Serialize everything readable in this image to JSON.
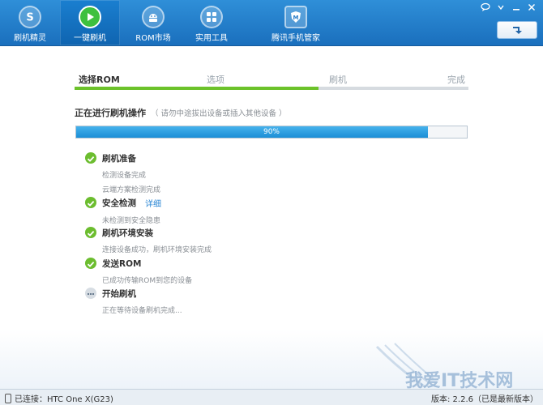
{
  "toolbar": {
    "tabs": [
      {
        "label": "刷机精灵",
        "icon": "shuaji-logo-icon"
      },
      {
        "label": "一键刷机",
        "icon": "play-icon",
        "active": true
      },
      {
        "label": "ROM市场",
        "icon": "android-icon"
      },
      {
        "label": "实用工具",
        "icon": "grid-icon"
      },
      {
        "label": "腾讯手机管家",
        "icon": "shield-m-icon"
      }
    ],
    "window_buttons": [
      "feedback-icon",
      "menu-icon",
      "minimize-icon",
      "close-icon"
    ],
    "update_icon": "arrow-update-icon"
  },
  "steps": {
    "items": [
      "选择ROM",
      "选项",
      "刷机",
      "完成"
    ],
    "current": "选择ROM",
    "progress_fraction": 0.62
  },
  "operation": {
    "title": "正在进行刷机操作",
    "hint": "（ 请勿中途拔出设备或插入其他设备 ）"
  },
  "progress": {
    "percent": 90,
    "text": "90%"
  },
  "tasks": [
    {
      "title": "刷机准备",
      "status": "done",
      "details": [
        "检测设备完成",
        "云端方案检测完成"
      ]
    },
    {
      "title": "安全检测",
      "status": "done",
      "link": "详细",
      "details": [
        "未检测到安全隐患"
      ]
    },
    {
      "title": "刷机环境安装",
      "status": "done",
      "details": [
        "连接设备成功，刷机环境安装完成"
      ]
    },
    {
      "title": "发送ROM",
      "status": "done",
      "details": [
        "已成功传输ROM到您的设备"
      ]
    },
    {
      "title": "开始刷机",
      "status": "pending",
      "details": [
        "正在等待设备刷机完成..."
      ]
    }
  ],
  "statusbar": {
    "connection": "已连接：HTC One X(G23)",
    "version": "版本: 2.2.6（已是最新版本）"
  },
  "watermark": {
    "text": "我爱IT技术网"
  },
  "colors": {
    "toolbar_blue": "#1a6fbd",
    "progress_blue": "#1b8ed6",
    "success_green": "#6cbd2f",
    "link_blue": "#2a86d4"
  }
}
